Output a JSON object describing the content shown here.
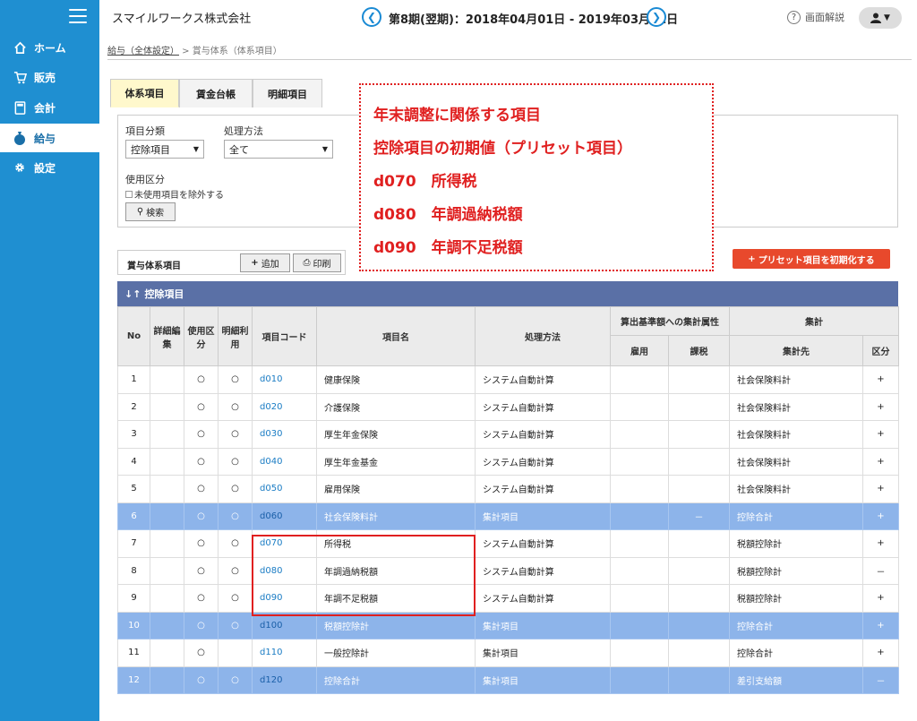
{
  "sidebar": {
    "items": [
      {
        "icon": "home-icon",
        "label": "ホーム"
      },
      {
        "icon": "cart-icon",
        "label": "販売"
      },
      {
        "icon": "calculator-icon",
        "label": "会計"
      },
      {
        "icon": "money-bag-icon",
        "label": "給与"
      },
      {
        "icon": "gear-icon",
        "label": "設定"
      }
    ],
    "active_index": 3,
    "color": "#1f8fd1"
  },
  "header": {
    "company": "スマイルワークス株式会社",
    "period": "第8期(翌期)：2018年04月01日 - 2019年03月31日",
    "prev_icon": "chevron-left-icon",
    "next_icon": "chevron-right-icon",
    "help_label": "画面解説",
    "user_icon": "user-icon"
  },
  "breadcrumb": {
    "link": "給与（全体設定）",
    "sep": " > ",
    "current": "賞与体系（体系項目）"
  },
  "tabs": [
    "体系項目",
    "賃金台帳",
    "明細項目"
  ],
  "filter": {
    "category_label": "項目分類",
    "category_value": "控除項目",
    "method_label": "処理方法",
    "method_value": "全て",
    "usage_label": "使用区分",
    "exclude_label": "未使用項目を除外する",
    "search_label": "検索"
  },
  "toolbar": {
    "label": "賞与体系項目",
    "add_label": "追加",
    "print_label": "印刷",
    "preset_label": "プリセット項目を初期化する",
    "preset_color": "#e8492c"
  },
  "callout": {
    "lines": [
      "年末調整に関係する項目",
      "控除項目の初期値（プリセット項目）",
      "d070　所得税",
      "d080　年調過納税額",
      "d090　年調不足税額"
    ],
    "color": "#e02020"
  },
  "table": {
    "title": "控除項目",
    "headers": {
      "no": "No",
      "detail": "詳細編集",
      "usage": "使用区分",
      "meisai": "明細利用",
      "code": "項目コード",
      "name": "項目名",
      "method": "処理方法",
      "calc_base": "算出基準額への集計属性",
      "koyou": "雇用",
      "kazei": "課税",
      "aggregate": "集計",
      "target": "集計先",
      "kubun": "区分"
    },
    "rows": [
      {
        "no": "1",
        "usage": "○",
        "meisai": "○",
        "code": "d010",
        "name": "健康保険",
        "method": "システム自動計算",
        "koyou": "",
        "kazei": "",
        "target": "社会保険料計",
        "kubun": "+",
        "hl": false
      },
      {
        "no": "2",
        "usage": "○",
        "meisai": "○",
        "code": "d020",
        "name": "介護保険",
        "method": "システム自動計算",
        "koyou": "",
        "kazei": "",
        "target": "社会保険料計",
        "kubun": "+",
        "hl": false
      },
      {
        "no": "3",
        "usage": "○",
        "meisai": "○",
        "code": "d030",
        "name": "厚生年金保険",
        "method": "システム自動計算",
        "koyou": "",
        "kazei": "",
        "target": "社会保険料計",
        "kubun": "+",
        "hl": false
      },
      {
        "no": "4",
        "usage": "○",
        "meisai": "○",
        "code": "d040",
        "name": "厚生年金基金",
        "method": "システム自動計算",
        "koyou": "",
        "kazei": "",
        "target": "社会保険料計",
        "kubun": "+",
        "hl": false
      },
      {
        "no": "5",
        "usage": "○",
        "meisai": "○",
        "code": "d050",
        "name": "雇用保険",
        "method": "システム自動計算",
        "koyou": "",
        "kazei": "",
        "target": "社会保険料計",
        "kubun": "+",
        "hl": false
      },
      {
        "no": "6",
        "usage": "○",
        "meisai": "○",
        "code": "d060",
        "name": "社会保険料計",
        "method": "集計項目",
        "koyou": "",
        "kazei": "－",
        "target": "控除合計",
        "kubun": "+",
        "hl": true
      },
      {
        "no": "7",
        "usage": "○",
        "meisai": "○",
        "code": "d070",
        "name": "所得税",
        "method": "システム自動計算",
        "koyou": "",
        "kazei": "",
        "target": "税額控除計",
        "kubun": "+",
        "hl": false
      },
      {
        "no": "8",
        "usage": "○",
        "meisai": "○",
        "code": "d080",
        "name": "年調過納税額",
        "method": "システム自動計算",
        "koyou": "",
        "kazei": "",
        "target": "税額控除計",
        "kubun": "－",
        "hl": false
      },
      {
        "no": "9",
        "usage": "○",
        "meisai": "○",
        "code": "d090",
        "name": "年調不足税額",
        "method": "システム自動計算",
        "koyou": "",
        "kazei": "",
        "target": "税額控除計",
        "kubun": "+",
        "hl": false
      },
      {
        "no": "10",
        "usage": "○",
        "meisai": "○",
        "code": "d100",
        "name": "税額控除計",
        "method": "集計項目",
        "koyou": "",
        "kazei": "",
        "target": "控除合計",
        "kubun": "+",
        "hl": true
      },
      {
        "no": "11",
        "usage": "○",
        "meisai": "",
        "code": "d110",
        "name": "一般控除計",
        "method": "集計項目",
        "koyou": "",
        "kazei": "",
        "target": "控除合計",
        "kubun": "+",
        "hl": false
      },
      {
        "no": "12",
        "usage": "○",
        "meisai": "○",
        "code": "d120",
        "name": "控除合計",
        "method": "集計項目",
        "koyou": "",
        "kazei": "",
        "target": "差引支給額",
        "kubun": "－",
        "hl": true
      }
    ],
    "highlight_color": "#8db4ea",
    "title_color": "#5a70a6"
  }
}
